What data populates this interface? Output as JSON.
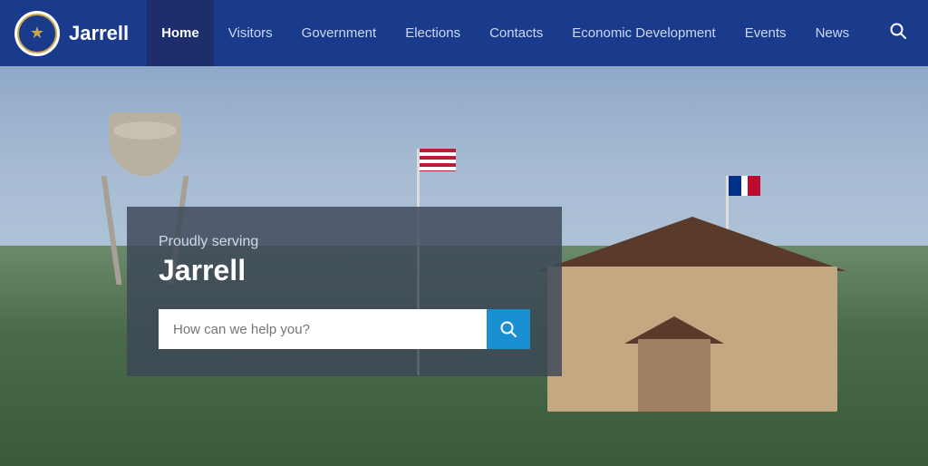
{
  "brand": {
    "name": "Jarrell",
    "logo_alt": "Jarrell Texas city seal"
  },
  "nav": {
    "items": [
      {
        "label": "Home",
        "active": true
      },
      {
        "label": "Visitors",
        "active": false
      },
      {
        "label": "Government",
        "active": false
      },
      {
        "label": "Elections",
        "active": false
      },
      {
        "label": "Contacts",
        "active": false
      },
      {
        "label": "Economic Development",
        "active": false
      },
      {
        "label": "Events",
        "active": false
      },
      {
        "label": "News",
        "active": false
      }
    ]
  },
  "hero": {
    "subtitle": "Proudly serving",
    "title": "Jarrell",
    "search_placeholder": "How can we help you?"
  }
}
